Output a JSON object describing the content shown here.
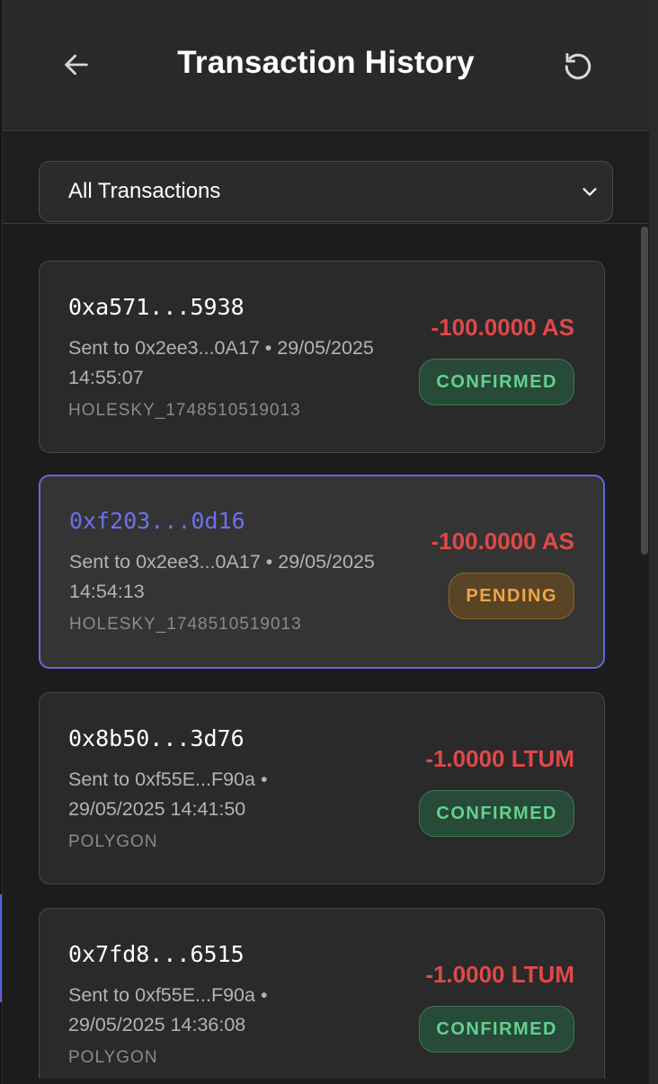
{
  "header": {
    "title": "Transaction History",
    "back_icon": "arrow-left-icon",
    "refresh_icon": "refresh-icon"
  },
  "filter": {
    "selected": "All Transactions",
    "icon": "chevron-down-icon"
  },
  "transactions": [
    {
      "hash": "0xa571...5938",
      "description": "Sent to 0x2ee3...0A17 • 29/05/2025 14:55:07",
      "network": "HOLESKY_1748510519013",
      "amount": "-100.0000 AS",
      "status": "CONFIRMED",
      "status_type": "confirmed"
    },
    {
      "hash": "0xf203...0d16",
      "description": "Sent to 0x2ee3...0A17 • 29/05/2025 14:54:13",
      "network": "HOLESKY_1748510519013",
      "amount": "-100.0000 AS",
      "status": "PENDING",
      "status_type": "pending"
    },
    {
      "hash": "0x8b50...3d76",
      "description": "Sent to 0xf55E...F90a • 29/05/2025 14:41:50",
      "network": "POLYGON",
      "amount": "-1.0000 LTUM",
      "status": "CONFIRMED",
      "status_type": "confirmed"
    },
    {
      "hash": "0x7fd8...6515",
      "description": "Sent to 0xf55E...F90a • 29/05/2025 14:36:08",
      "network": "POLYGON",
      "amount": "-1.0000 LTUM",
      "status": "CONFIRMED",
      "status_type": "confirmed"
    }
  ],
  "colors": {
    "background": "#1c1c1c",
    "card": "#2a2a2a",
    "accent": "#6466e0",
    "negative_amount": "#e04848",
    "confirmed": "#64d08e",
    "pending": "#eda546"
  }
}
